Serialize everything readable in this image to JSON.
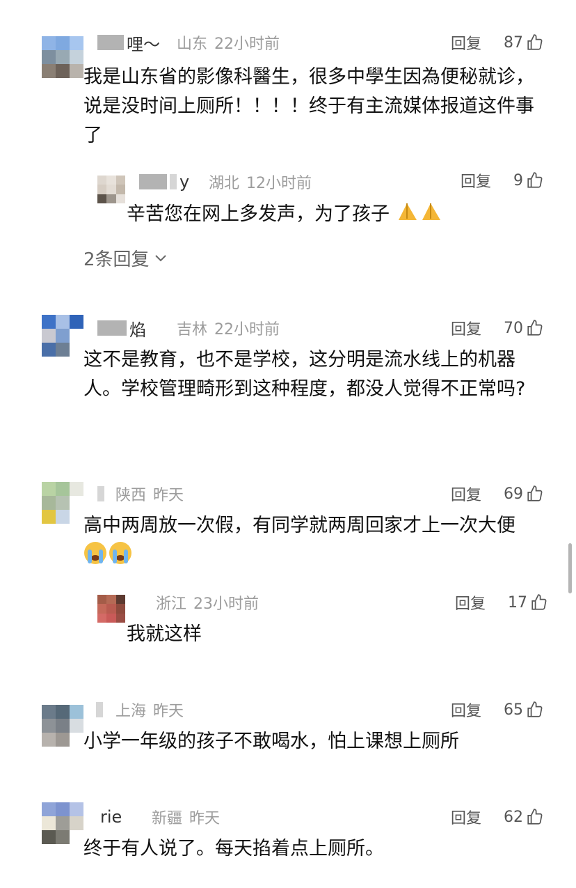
{
  "reply_label": "回复",
  "comments": [
    {
      "nick_suffix": "哩～",
      "location": "山东",
      "time": "22小时前",
      "likes": "87",
      "text": "我是山东省的影像科醫生，很多中學生因為便秘就诊，说是没时间上厕所！！！！终于有主流媒体报道这件事了",
      "replies": [
        {
          "nick_suffix": "y",
          "location": "湖北",
          "time": "12小时前",
          "likes": "9",
          "text": "辛苦您在网上多发声，为了孩子"
        }
      ],
      "more_replies": "2条回复"
    },
    {
      "nick_suffix": "焰",
      "location": "吉林",
      "time": "22小时前",
      "likes": "70",
      "text": "这不是教育，也不是学校，这分明是流水线上的机器人。学校管理畸形到这种程度，都没人觉得不正常吗?"
    },
    {
      "nick_suffix": "",
      "location": "陕西",
      "time": "昨天",
      "likes": "69",
      "text": "高中两周放一次假，有同学就两周回家才上一次大便",
      "replies": [
        {
          "nick_suffix": "",
          "location": "浙江",
          "time": "23小时前",
          "likes": "17",
          "text": "我就这样"
        }
      ]
    },
    {
      "nick_suffix": "",
      "location": "上海",
      "time": "昨天",
      "likes": "65",
      "text": "小学一年级的孩子不敢喝水，怕上课想上厕所"
    },
    {
      "nick_suffix": "rie",
      "location": "新疆",
      "time": "昨天",
      "likes": "62",
      "text": "终于有人说了。每天掐着点上厕所。"
    }
  ]
}
